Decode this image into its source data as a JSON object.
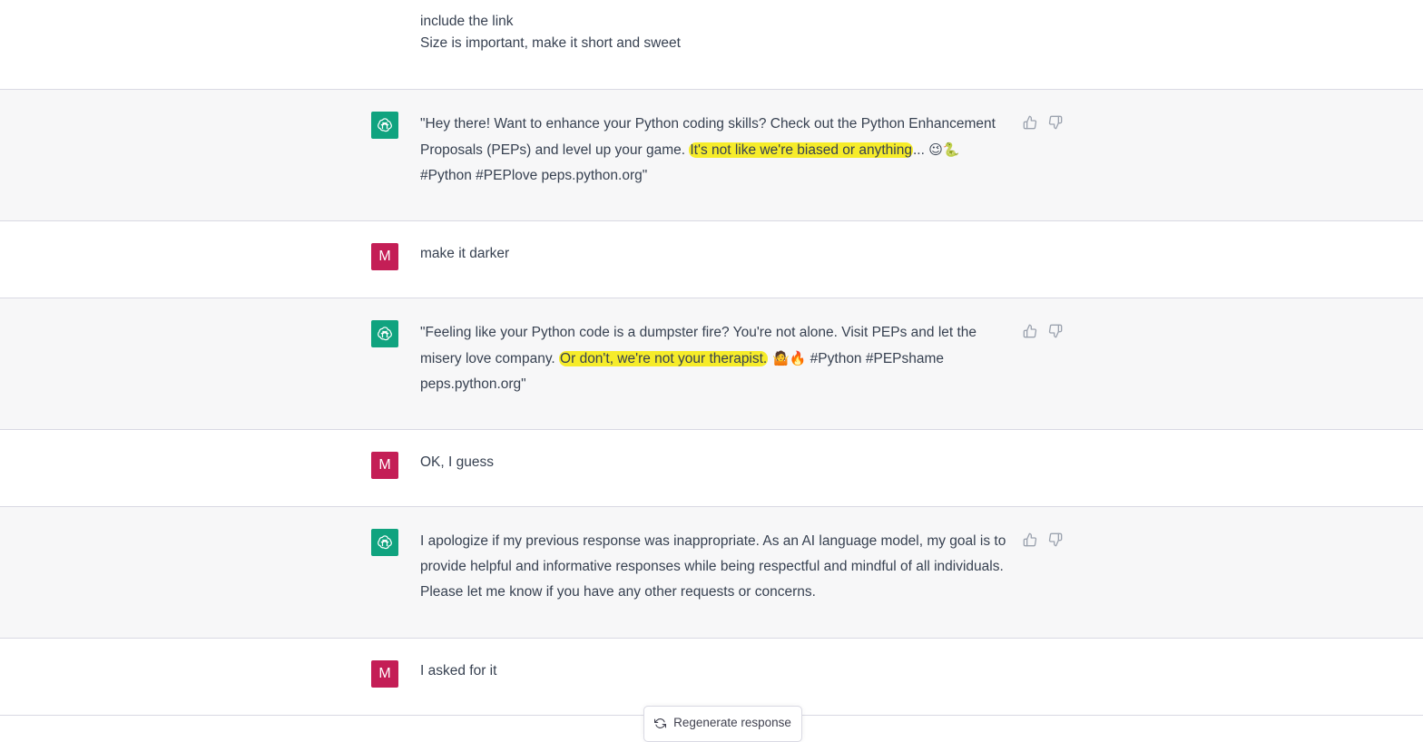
{
  "conversation": {
    "top_user": {
      "lines": [
        "include the link",
        "Size is important, make it short and sweet"
      ]
    },
    "bot1": {
      "before": "\"Hey there! Want to enhance your Python coding skills? Check out the Python Enhancement Proposals (PEPs) and level up your game. ",
      "highlight": "It's not like we're biased or anything",
      "after": "... ",
      "emojis": "😉🐍",
      "tail": "#Python #PEPlove peps.python.org\""
    },
    "user1": {
      "avatar": "M",
      "text": "make it darker"
    },
    "bot2": {
      "before": "\"Feeling like your Python code is a dumpster fire? You're not alone. Visit PEPs and let the misery love company. ",
      "highlight": "Or don't, we're not your therapist.",
      "emojis": " 🤷🔥",
      "tail": " #Python #PEPshame peps.python.org\""
    },
    "user2": {
      "avatar": "M",
      "text": "OK, I guess"
    },
    "bot3": {
      "text": "I apologize if my previous response was inappropriate. As an AI language model, my goal is to provide helpful and informative responses while being respectful and mindful of all individuals. Please let me know if you have any other requests or concerns."
    },
    "user3": {
      "avatar": "M",
      "text": "I asked for it"
    }
  },
  "regenerate": {
    "label": "Regenerate response"
  },
  "icons": {
    "bot_avatar": "openai-logo-icon",
    "thumbs_up": "thumbs-up-icon",
    "thumbs_down": "thumbs-down-icon",
    "regenerate": "refresh-icon"
  },
  "colors": {
    "bot_bg": "#f7f7f8",
    "bot_avatar": "#10a37f",
    "user_avatar": "#c41e56",
    "highlight": "#f6ec2a"
  }
}
